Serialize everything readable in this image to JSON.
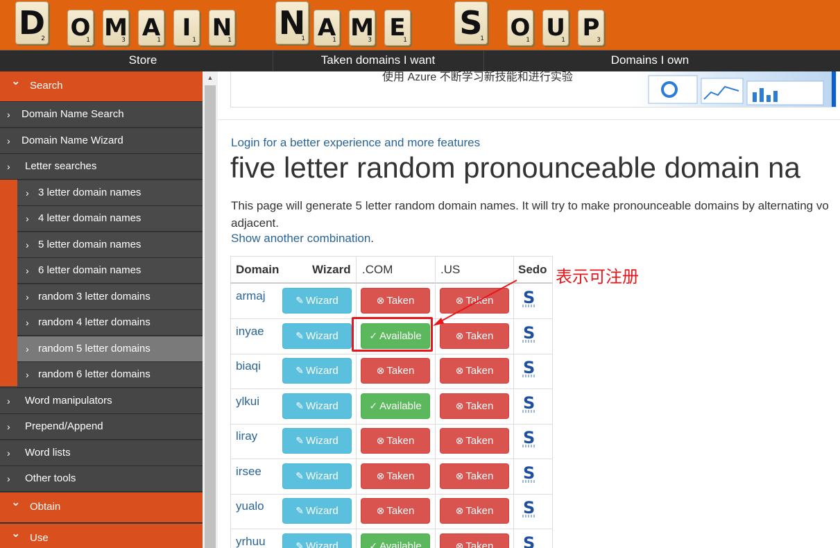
{
  "header": {
    "logo_letters": [
      {
        "ch": "D",
        "score": "2",
        "size": "lg"
      },
      {
        "ch": "O",
        "score": "1",
        "size": "sm"
      },
      {
        "ch": "M",
        "score": "3",
        "size": "sm"
      },
      {
        "ch": "A",
        "score": "1",
        "size": "sm"
      },
      {
        "ch": "I",
        "score": "1",
        "size": "sm"
      },
      {
        "ch": "N",
        "score": "1",
        "size": "sm"
      },
      {
        "ch": "N",
        "score": "1",
        "size": "lg"
      },
      {
        "ch": "A",
        "score": "1",
        "size": "sm"
      },
      {
        "ch": "M",
        "score": "3",
        "size": "sm"
      },
      {
        "ch": "E",
        "score": "1",
        "size": "sm"
      },
      {
        "ch": "S",
        "score": "1",
        "size": "lg"
      },
      {
        "ch": "O",
        "score": "1",
        "size": "sm"
      },
      {
        "ch": "U",
        "score": "1",
        "size": "sm"
      },
      {
        "ch": "P",
        "score": "3",
        "size": "sm"
      }
    ],
    "nav": [
      "Store",
      "Taken domains I want",
      "Domains I own"
    ]
  },
  "sidebar": {
    "search_section": "Search",
    "items_top": [
      "Domain Name Search",
      "Domain Name Wizard",
      "Letter searches"
    ],
    "sub_items": [
      "3 letter domain names",
      "4 letter domain names",
      "5 letter domain names",
      "6 letter domain names",
      "random 3 letter domains",
      "random 4 letter domains",
      "random 5 letter domains",
      "random 6 letter domains"
    ],
    "active_sub_index": 6,
    "items_bottom": [
      "Word manipulators",
      "Prepend/Append",
      "Word lists",
      "Other tools"
    ],
    "obtain_section": "Obtain",
    "use_section": "Use"
  },
  "ad": {
    "text": "使用 Azure 不断学习新技能和进行实验"
  },
  "main": {
    "login_link": "Login for a better experience and more features",
    "title": "five letter random pronounceable domain na",
    "description_line1": "This page will generate 5 letter random domain names. It will try to make pronounceable domains by alternating vo",
    "description_line2": "adjacent.",
    "show_link": "Show another combination",
    "show_link_suffix": "."
  },
  "table": {
    "headers": [
      "Domain",
      "Wizard",
      ".COM",
      ".US",
      "Sedo"
    ],
    "wizard_label": "Wizard",
    "rows": [
      {
        "domain": "armaj",
        "com": "Taken",
        "us": "Taken"
      },
      {
        "domain": "inyae",
        "com": "Available",
        "us": "Taken"
      },
      {
        "domain": "biaqi",
        "com": "Taken",
        "us": "Taken"
      },
      {
        "domain": "ylkui",
        "com": "Available",
        "us": "Taken"
      },
      {
        "domain": "liray",
        "com": "Taken",
        "us": "Taken"
      },
      {
        "domain": "irsee",
        "com": "Taken",
        "us": "Taken"
      },
      {
        "domain": "yualo",
        "com": "Taken",
        "us": "Taken"
      },
      {
        "domain": "yrhuu",
        "com": "Available",
        "us": "Taken"
      }
    ]
  },
  "annotation": {
    "text": "表示可注册"
  },
  "colors": {
    "header_orange": "#e0630f",
    "section_orange": "#d9501e",
    "taken_red": "#d9534f",
    "available_green": "#5cb85c",
    "wizard_blue": "#5bc0de",
    "link_blue": "#2a6496",
    "annotation_red": "#e8161b"
  }
}
